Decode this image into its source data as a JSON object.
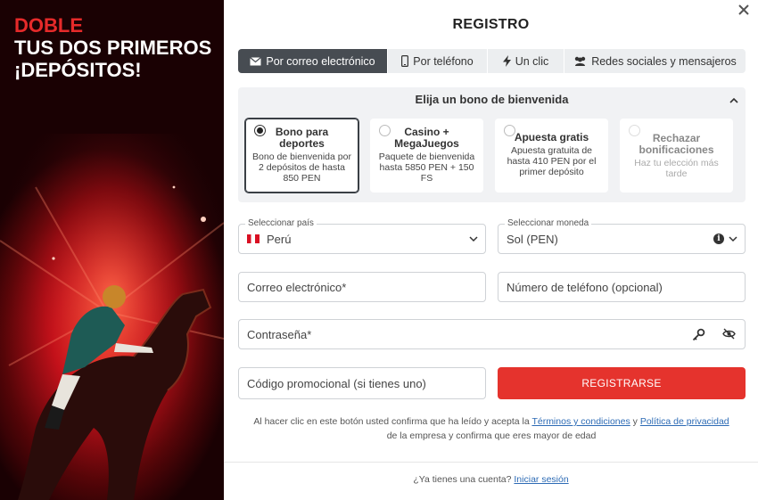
{
  "promo": {
    "line1": "DOBLE",
    "line2": "TUS DOS PRIMEROS",
    "line3": "¡DEPÓSITOS!"
  },
  "modal": {
    "title": "REGISTRO",
    "close_icon": "close-icon"
  },
  "tabs": [
    {
      "label": "Por correo electrónico",
      "icon": "envelope-icon",
      "active": true
    },
    {
      "label": "Por teléfono",
      "icon": "phone-icon",
      "active": false
    },
    {
      "label": "Un clic",
      "icon": "lightning-icon",
      "active": false
    },
    {
      "label": "Redes sociales y mensajeros",
      "icon": "users-icon",
      "active": false
    }
  ],
  "bonus": {
    "heading": "Elija un bono de bienvenida",
    "cards": [
      {
        "title": "Bono para deportes",
        "desc": "Bono de bienvenida por 2 depósitos de hasta 850 PEN",
        "selected": true
      },
      {
        "title": "Casino + MegaJuegos",
        "desc": "Paquete de bienvenida hasta 5850 PEN + 150 FS",
        "selected": false
      },
      {
        "title": "Apuesta gratis",
        "desc": "Apuesta gratuita de hasta 410 PEN por el primer depósito",
        "selected": false
      },
      {
        "title": "Rechazar bonificaciones",
        "desc": "Haz tu elección más tarde",
        "selected": false
      }
    ]
  },
  "form": {
    "country_label": "Seleccionar país",
    "country_value": "Perú",
    "currency_label": "Seleccionar moneda",
    "currency_value": "Sol (PEN)",
    "email_placeholder": "Correo electrónico*",
    "phone_placeholder": "Número de teléfono (opcional)",
    "password_placeholder": "Contraseña*",
    "promo_placeholder": "Código promocional (si tienes uno)",
    "register_button": "REGISTRARSE"
  },
  "terms": {
    "prefix": "Al hacer clic en este botón usted confirma que ha leído y acepta la",
    "terms_link": "Términos y condiciones",
    "joiner": "y",
    "privacy_link": "Política de privacidad",
    "suffix": "de la empresa y confirma que eres mayor de edad"
  },
  "footer": {
    "question": "¿Ya tienes una cuenta?",
    "login_link": "Iniciar sesión"
  },
  "colors": {
    "accent_red": "#e5332d",
    "active_tab": "#474c52",
    "link": "#2d6bb5"
  }
}
